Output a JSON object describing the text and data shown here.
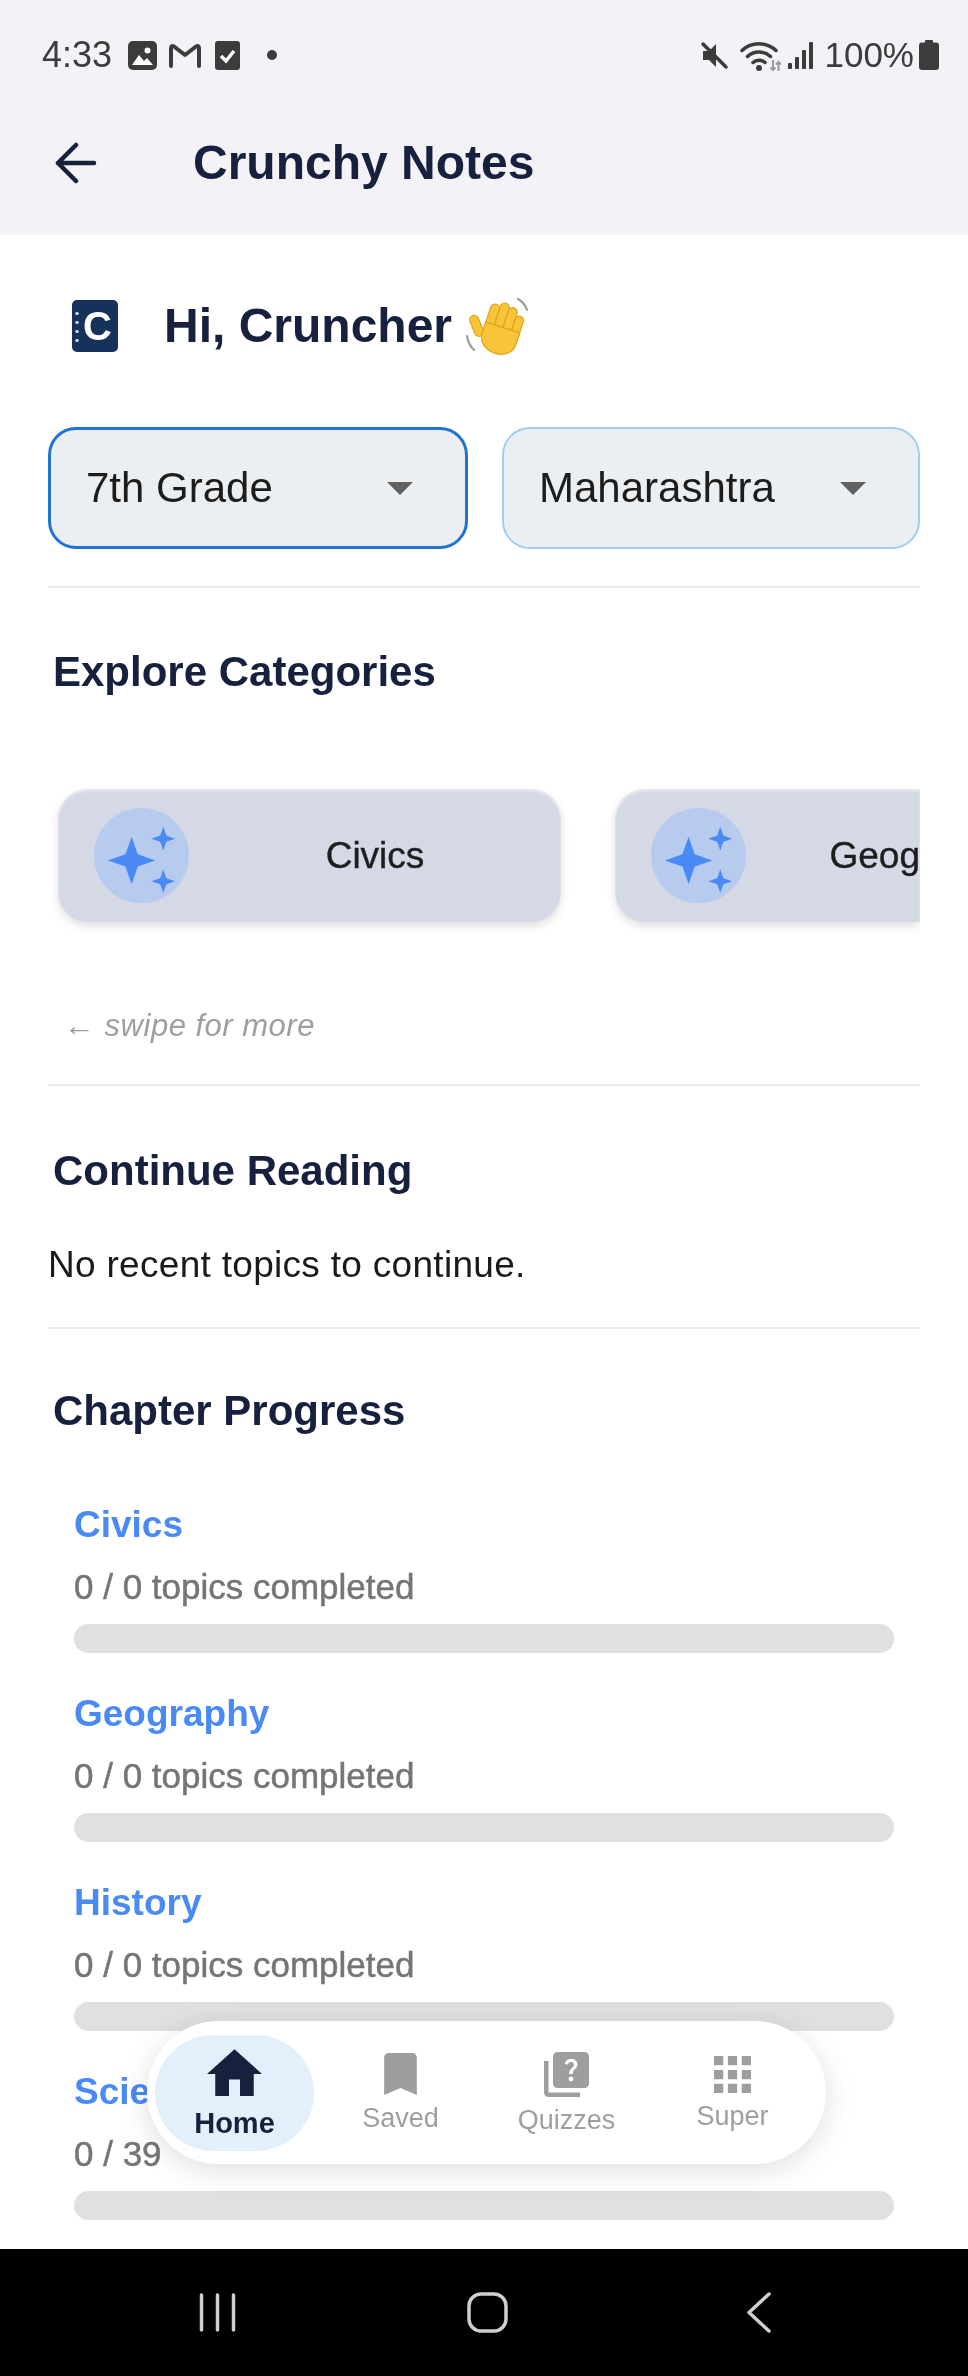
{
  "status_bar": {
    "time": "4:33",
    "battery": "100%"
  },
  "header": {
    "title": "Crunchy Notes"
  },
  "greeting": {
    "logo_letter": "C",
    "text": "Hi, Cruncher"
  },
  "filters": [
    {
      "value": "7th Grade",
      "focused": true
    },
    {
      "value": "Maharashtra",
      "focused": false
    }
  ],
  "explore_categories": {
    "title": "Explore Categories",
    "categories": [
      {
        "label": "Civics"
      },
      {
        "label": "Geog"
      }
    ],
    "hint": "← swipe for more"
  },
  "continue_reading": {
    "title": "Continue Reading",
    "message": "No recent topics to continue."
  },
  "chapter_progress": {
    "title": "Chapter Progress",
    "chapters": [
      {
        "name": "Civics",
        "progress": "0 / 0 topics completed",
        "level": 0
      },
      {
        "name": "Geography",
        "progress": "0 / 0 topics completed",
        "level": 0
      },
      {
        "name": "History",
        "progress": "0 / 0 topics completed",
        "level": 0
      },
      {
        "name": "Scie",
        "progress": "0 / 39",
        "level": 0
      }
    ]
  },
  "bottom_nav": [
    {
      "label": "Home",
      "selected": true
    },
    {
      "label": "Saved",
      "selected": false
    },
    {
      "label": "Quizzes",
      "selected": false
    },
    {
      "label": "Super",
      "selected": false
    }
  ]
}
